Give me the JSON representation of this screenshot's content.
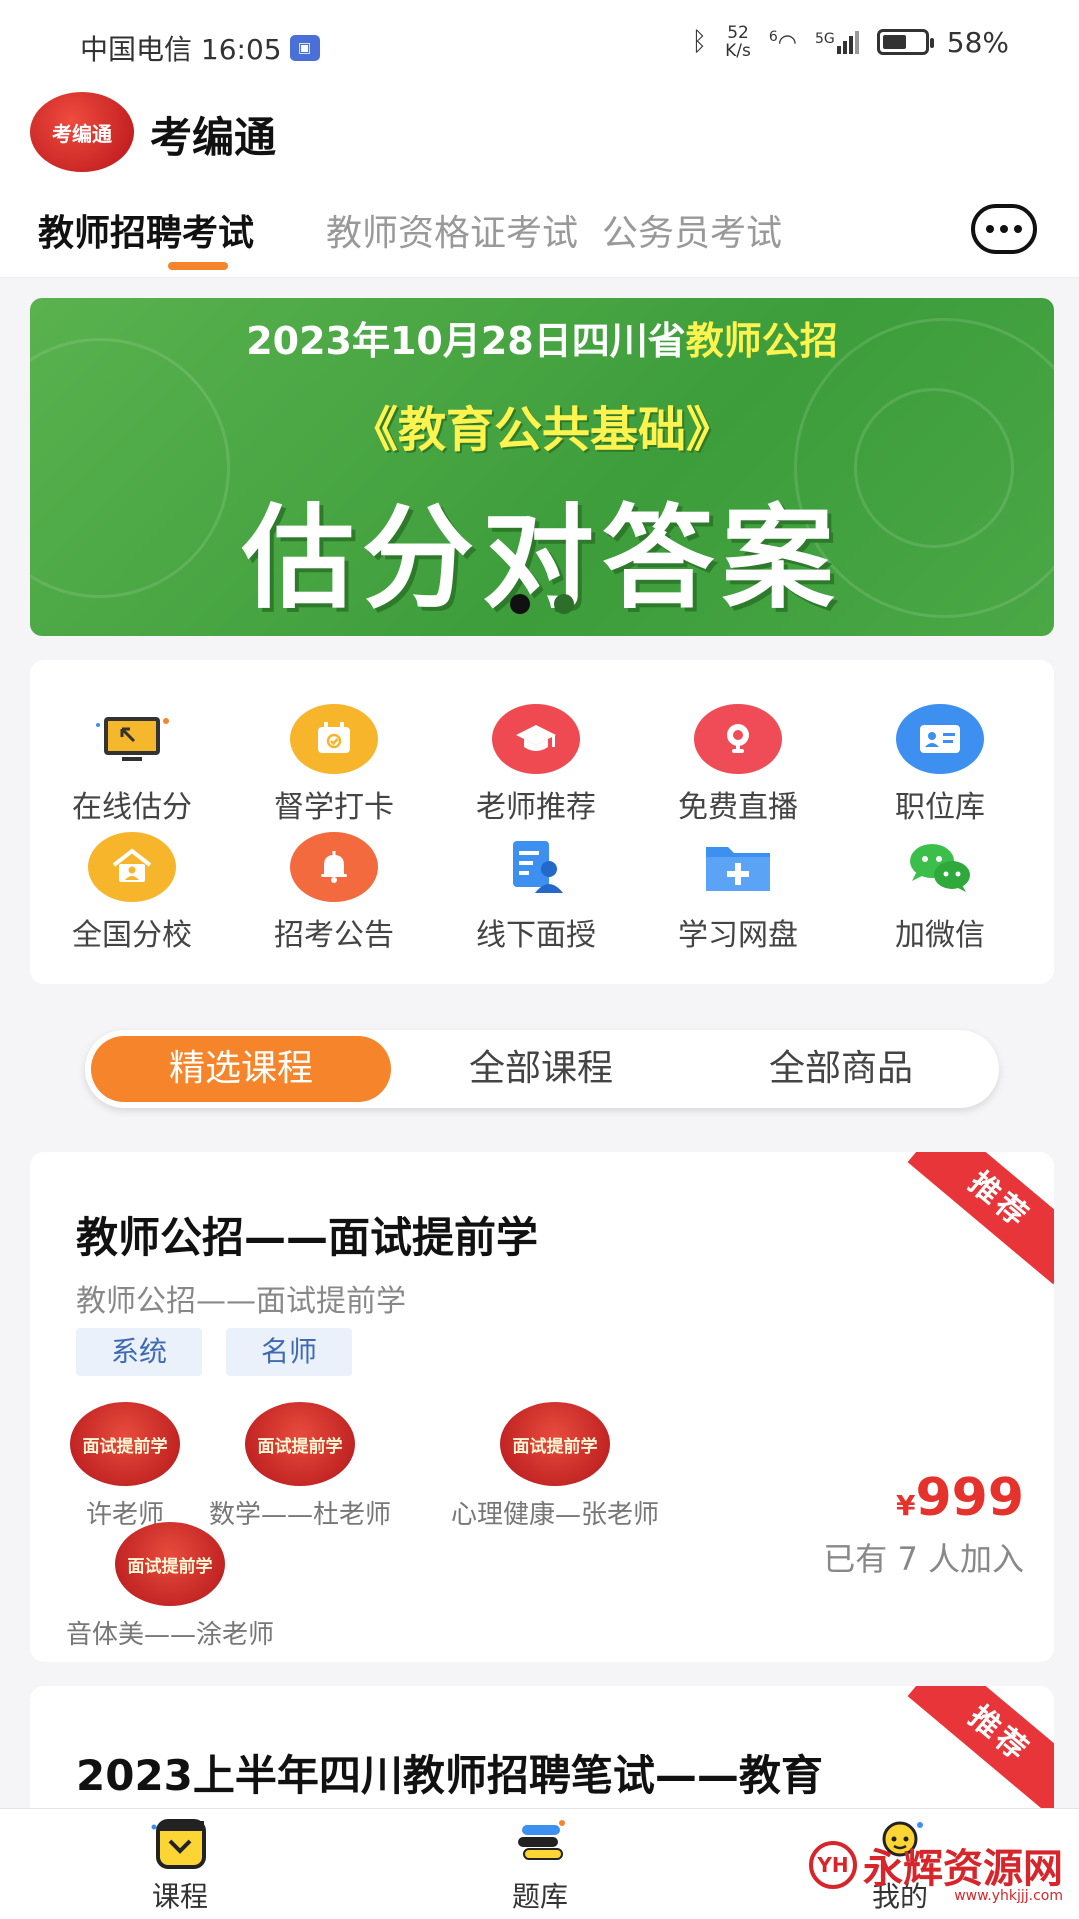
{
  "status_bar": {
    "carrier_time": "中国电信 16:05",
    "net_speed_value": "52",
    "net_speed_unit": "K/s",
    "signal_label": "5G",
    "wifi_label": "6",
    "battery": "58%",
    "battery_level": 0.58
  },
  "header": {
    "logo_text": "考编通",
    "app_name": "考编通"
  },
  "tabs": [
    {
      "label": "教师招聘考试",
      "active": true
    },
    {
      "label": "教师资格证考试",
      "active": false
    },
    {
      "label": "公务员考试",
      "active": false
    }
  ],
  "banner": {
    "line1_prefix": "2023年10月28日四川省",
    "line1_highlight": "教师公招",
    "line2": "《教育公共基础》",
    "line3": "估分对答案",
    "page_count": 2,
    "current_page": 1
  },
  "quick_grid": [
    {
      "label": "在线估分",
      "icon": "monitor-icon",
      "color": "#f5b72b"
    },
    {
      "label": "督学打卡",
      "icon": "calendar-check-icon",
      "color": "#f7b52c"
    },
    {
      "label": "老师推荐",
      "icon": "graduation-cap-icon",
      "color": "#ef4a52"
    },
    {
      "label": "免费直播",
      "icon": "webcam-icon",
      "color": "#f04c58"
    },
    {
      "label": "职位库",
      "icon": "id-card-icon",
      "color": "#3d8ff0"
    },
    {
      "label": "全国分校",
      "icon": "school-house-icon",
      "color": "#f7b52c"
    },
    {
      "label": "招考公告",
      "icon": "bell-icon",
      "color": "#f26a3d"
    },
    {
      "label": "线下面授",
      "icon": "teacher-document-icon",
      "color": "#3d8ff0"
    },
    {
      "label": "学习网盘",
      "icon": "folder-plus-icon",
      "color": "#3d8ff0"
    },
    {
      "label": "加微信",
      "icon": "wechat-icon",
      "color": "#3cbf4a"
    }
  ],
  "segment": {
    "items": [
      "精选课程",
      "全部课程",
      "全部商品"
    ],
    "active_index": 0
  },
  "courses": [
    {
      "ribbon": "推荐",
      "title": "教师公招——面试提前学",
      "subtitle": "教师公招——面试提前学",
      "tags": [
        "系统",
        "名师"
      ],
      "avatar_text": "面试提前学",
      "teachers": [
        "许老师",
        "数学——杜老师",
        "心理健康—张老师",
        "音体美——涂老师"
      ],
      "price_currency": "¥",
      "price": "999",
      "joined": "已有 7 人加入"
    },
    {
      "ribbon": "推荐",
      "title": "2023上半年四川教师招聘笔试——教育"
    }
  ],
  "bottom_nav": [
    {
      "label": "课程",
      "icon": "course-icon"
    },
    {
      "label": "题库",
      "icon": "question-bank-icon"
    },
    {
      "label": "我的",
      "icon": "profile-icon"
    }
  ],
  "watermark": {
    "logo": "YH",
    "text": "永辉资源网",
    "url": "www.yhkjjj.com"
  },
  "colors": {
    "accent": "#f5842b",
    "price": "#e5322d",
    "banner_green": "#4aa845",
    "ribbon_red": "#e8353a"
  }
}
